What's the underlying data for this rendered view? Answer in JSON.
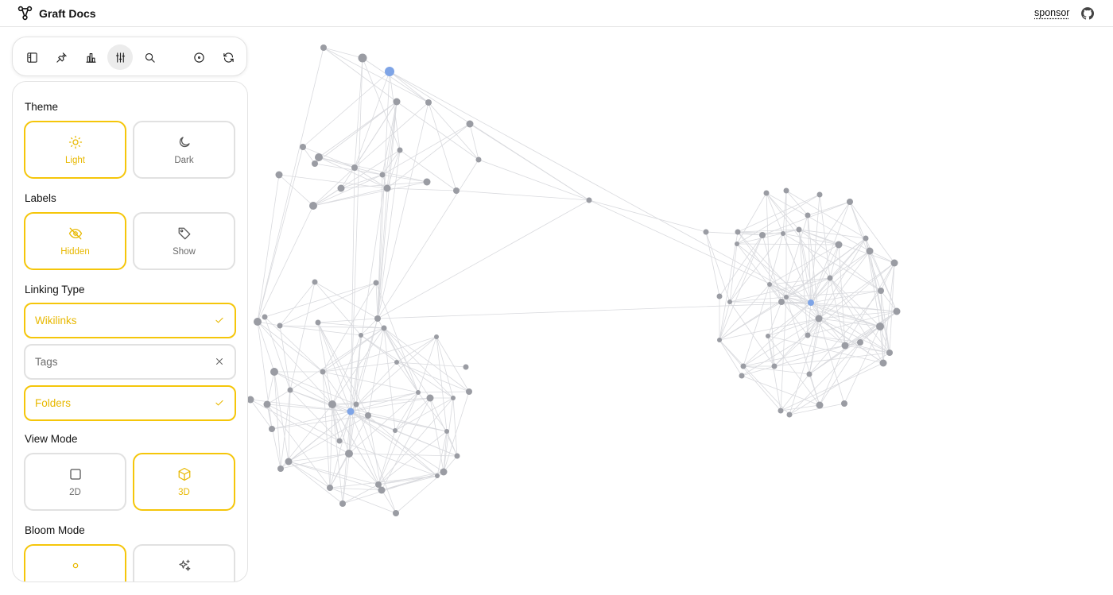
{
  "header": {
    "brand": "Graft Docs",
    "brand_icon": "graph-logo-icon",
    "sponsor": "sponsor",
    "github_icon": "github-icon"
  },
  "toolbar": {
    "buttons": [
      {
        "name": "sidebar-toggle",
        "icon": "sidebar-icon"
      },
      {
        "name": "pin",
        "icon": "pin-icon"
      },
      {
        "name": "stats",
        "icon": "bar-chart-icon"
      },
      {
        "name": "settings",
        "icon": "sliders-icon",
        "active": true
      },
      {
        "name": "search",
        "icon": "search-icon"
      },
      {
        "name": "focus",
        "icon": "target-icon"
      },
      {
        "name": "refresh",
        "icon": "refresh-icon"
      }
    ]
  },
  "settings": {
    "theme": {
      "title": "Theme",
      "options": [
        {
          "label": "Light",
          "icon": "sun-icon",
          "selected": true
        },
        {
          "label": "Dark",
          "icon": "moon-icon",
          "selected": false
        }
      ]
    },
    "labels": {
      "title": "Labels",
      "options": [
        {
          "label": "Hidden",
          "icon": "eye-off-icon",
          "selected": true
        },
        {
          "label": "Show",
          "icon": "tag-icon",
          "selected": false
        }
      ]
    },
    "linking": {
      "title": "Linking Type",
      "options": [
        {
          "label": "Wikilinks",
          "selected": true,
          "mark": "check-icon"
        },
        {
          "label": "Tags",
          "selected": false,
          "mark": "x-icon"
        },
        {
          "label": "Folders",
          "selected": true,
          "mark": "check-icon"
        }
      ]
    },
    "view_mode": {
      "title": "View Mode",
      "options": [
        {
          "label": "2D",
          "icon": "square-icon",
          "selected": false
        },
        {
          "label": "3D",
          "icon": "cube-icon",
          "selected": true
        }
      ]
    },
    "bloom": {
      "title": "Bloom Mode",
      "options": [
        {
          "label": "",
          "icon": "circle-icon",
          "selected": true
        },
        {
          "label": "",
          "icon": "sparkles-icon",
          "selected": false
        }
      ]
    }
  },
  "graph": {
    "colors": {
      "node": "#9a9ca3",
      "highlight": "#7ea4e6",
      "edge": "#d9dade"
    }
  }
}
